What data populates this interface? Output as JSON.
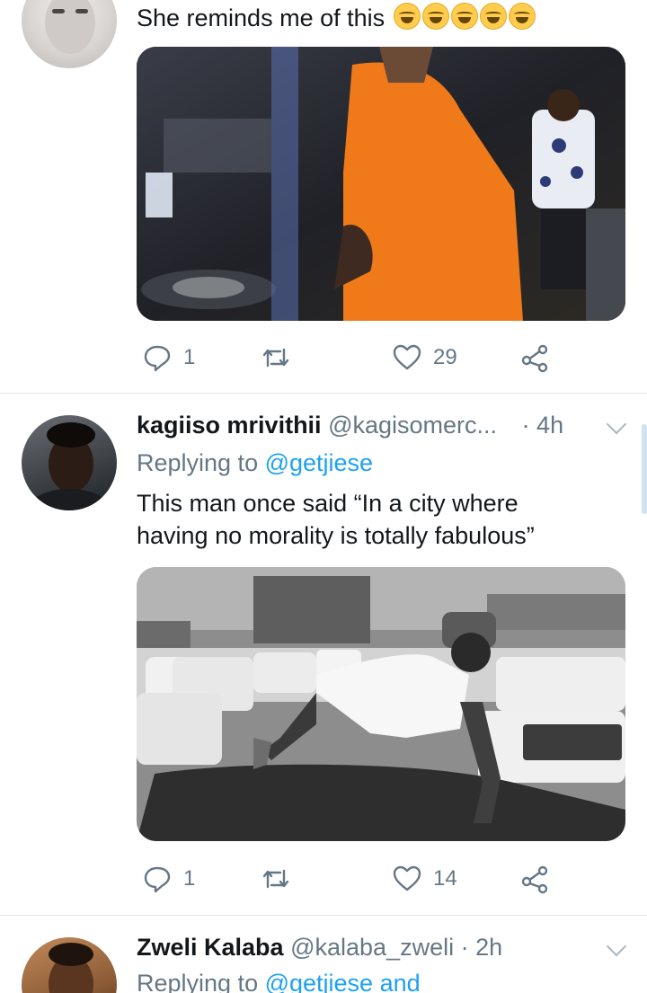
{
  "tweets": [
    {
      "text": "She reminds me of  this",
      "emoji": [
        "face-with-tears-of-joy",
        "face-with-tears-of-joy",
        "rolling-on-the-floor-laughing",
        "rolling-on-the-floor-laughing",
        "rolling-on-the-floor-laughing"
      ],
      "media_desc": "photo",
      "replies": "1",
      "likes": "29"
    },
    {
      "name": "kagiiso mrivithii",
      "handle": "@kagisomerc...",
      "time": "· 4h",
      "replying_prefix": "Replying to ",
      "replying_to": "@getjiese",
      "text_line1": "This man once said “In a city where",
      "text_line2": "having no morality is totally fabulous”",
      "replies": "1",
      "likes": "14"
    },
    {
      "name": "Zweli Kalaba",
      "handle": "@kalaba_zweli",
      "time": "· 2h",
      "replying_prefix": "Replying to ",
      "replying_to": "@getjiese and"
    }
  ],
  "colors": {
    "text": "#14171a",
    "secondary": "#657786",
    "link": "#1da1f2",
    "divider": "#e1e8ed"
  },
  "icons": [
    "reply-icon",
    "retweet-icon",
    "like-icon",
    "share-icon",
    "chevron-down-icon"
  ]
}
